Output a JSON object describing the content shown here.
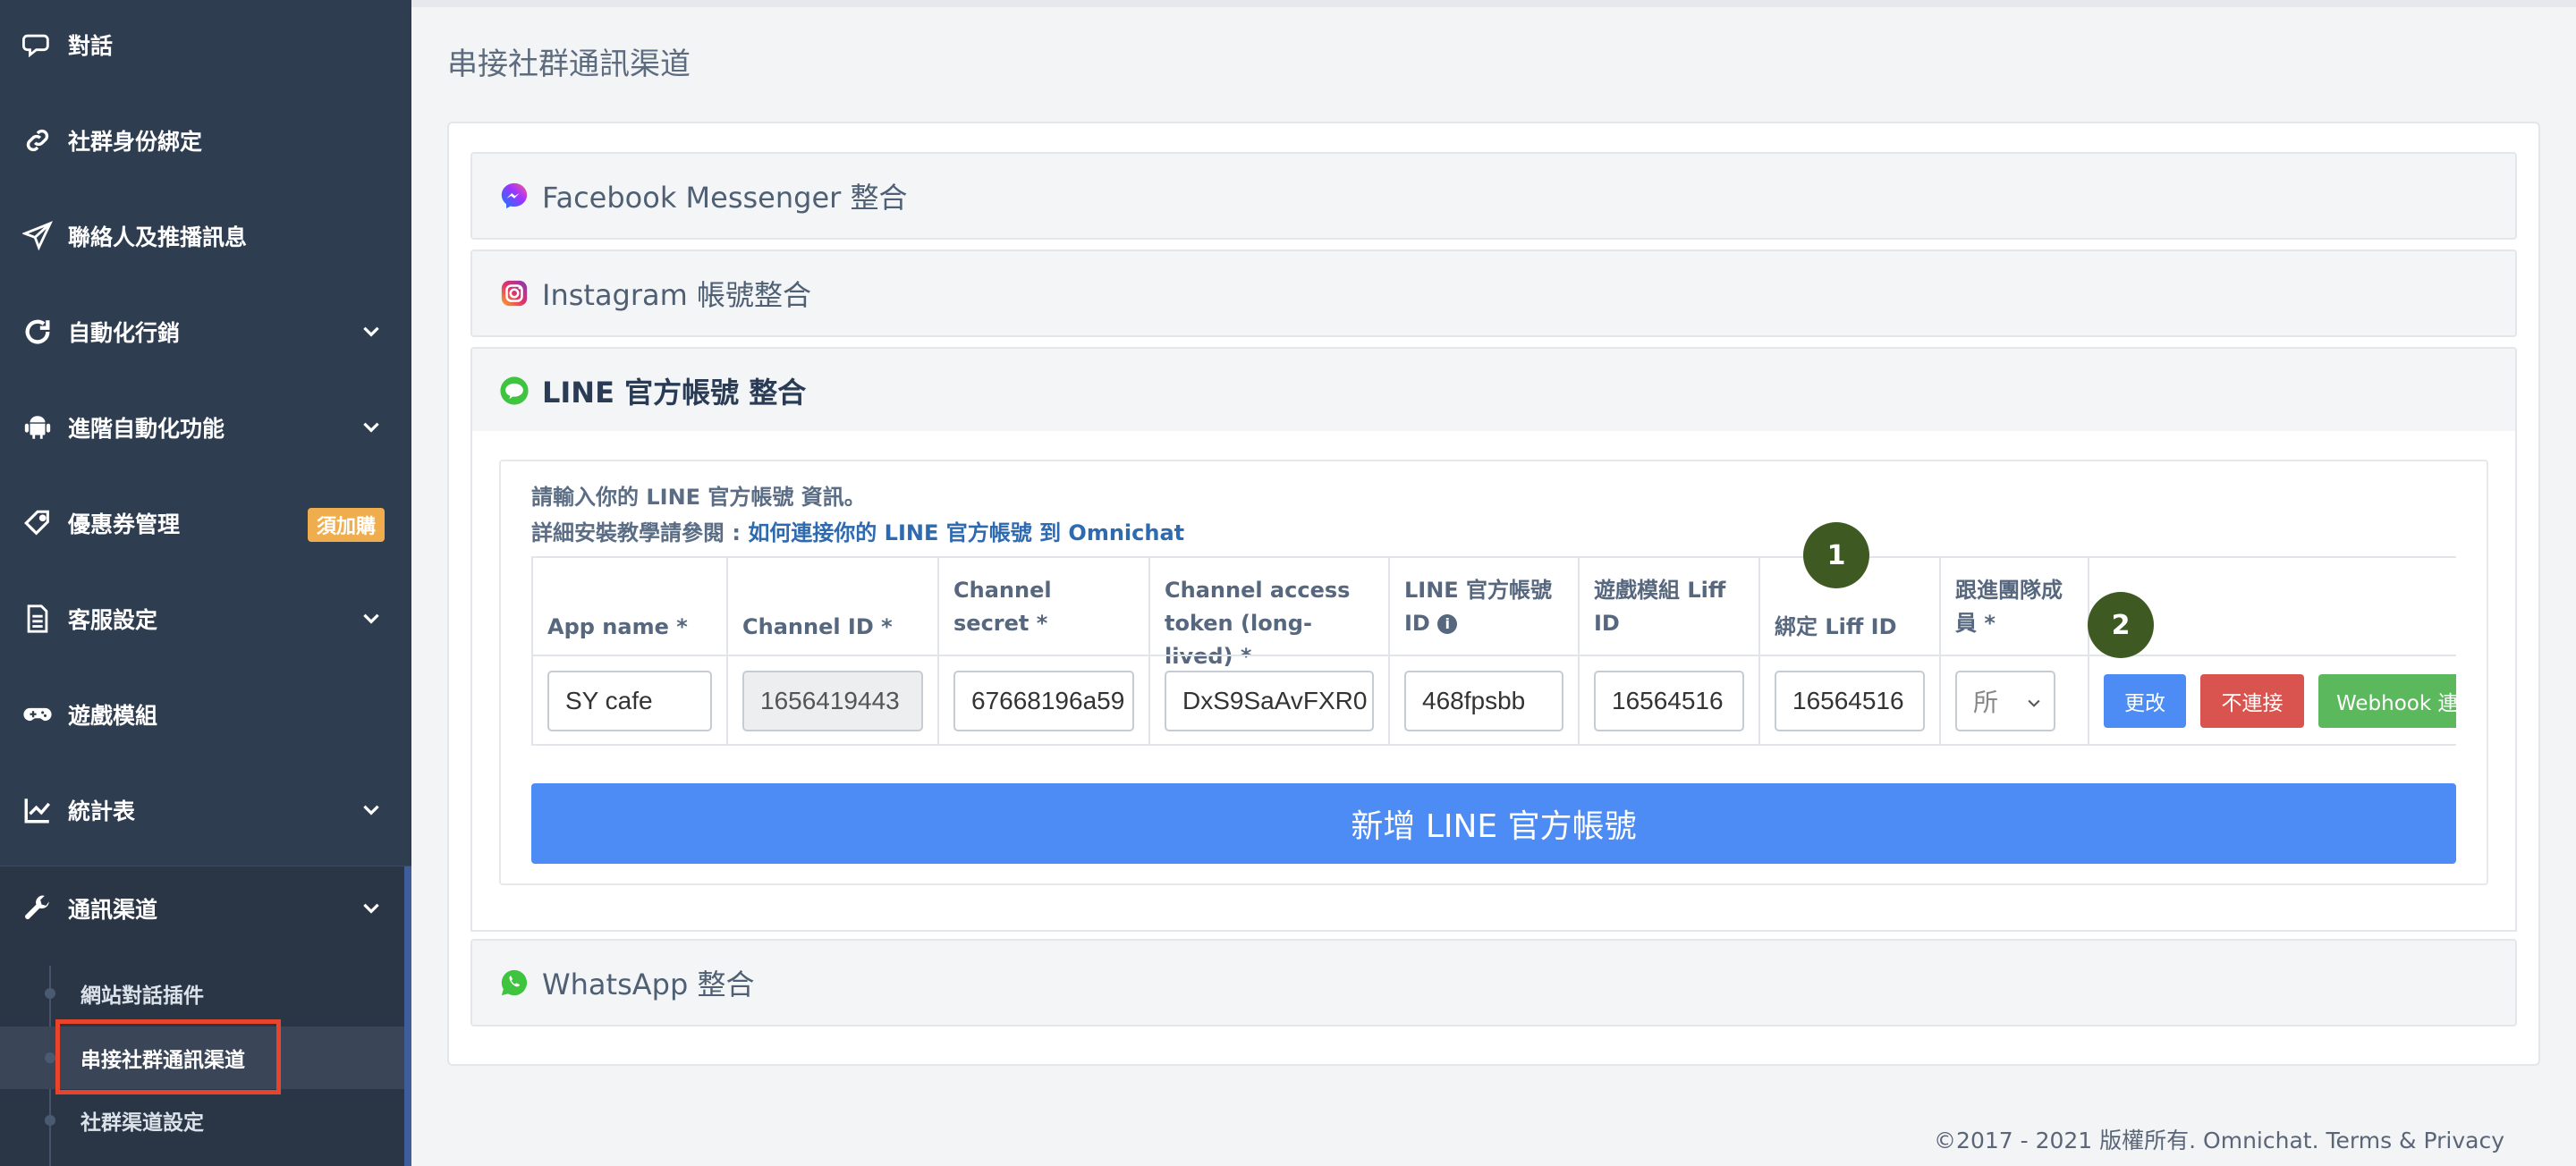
{
  "sidebar": {
    "items": [
      {
        "label": "對話",
        "icon": "chat-icon"
      },
      {
        "label": "社群身份綁定",
        "icon": "link-icon"
      },
      {
        "label": "聯絡人及推播訊息",
        "icon": "paper-plane-icon"
      },
      {
        "label": "自動化行銷",
        "icon": "refresh-icon"
      },
      {
        "label": "進階自動化功能",
        "icon": "android-icon"
      },
      {
        "label": "優惠券管理",
        "icon": "tag-icon",
        "badge": "須加購"
      },
      {
        "label": "客服設定",
        "icon": "document-icon"
      },
      {
        "label": "遊戲模組",
        "icon": "gamepad-icon"
      },
      {
        "label": "統計表",
        "icon": "line-chart-icon"
      },
      {
        "label": "通訊渠道",
        "icon": "wrench-icon"
      }
    ],
    "sub_items": [
      {
        "label": "網站對話插件"
      },
      {
        "label": "串接社群通訊渠道"
      },
      {
        "label": "社群渠道設定"
      }
    ]
  },
  "main": {
    "title": "串接社群通訊渠道",
    "panels": {
      "facebook": "Facebook Messenger 整合",
      "instagram": "Instagram 帳號整合",
      "line": "LINE 官方帳號 整合",
      "whatsapp": "WhatsApp 整合"
    },
    "line": {
      "intro_line1": "請輸入你的 LINE 官方帳號 資訊。",
      "intro_line2_prefix": "詳細安裝教學請參閱 : ",
      "intro_line2_link": "如何連接你的 LINE 官方帳號 到 Omnichat",
      "columns": {
        "app_name": "App name *",
        "channel_id": "Channel ID *",
        "channel_secret": "Channel secret *",
        "access_token": "Channel access token (long-lived) *",
        "official_id": "LINE 官方帳號 ID",
        "game_liff": "遊戲模組 Liff ID",
        "bind_liff": "綁定 Liff ID",
        "team_member": "跟進團隊成員 *"
      },
      "row": {
        "app_name": "SY cafe",
        "channel_id": "1656419443",
        "channel_secret": "67668196a59",
        "access_token": "DxS9SaAvFXR0",
        "official_id": "468fpsbb",
        "game_liff": "16564516",
        "bind_liff": "16564516",
        "team_member": "所"
      },
      "actions": {
        "edit": "更改",
        "disconnect": "不連接",
        "webhook": "Webhook 連結"
      },
      "add_button": "新增 LINE 官方帳號"
    },
    "markers": [
      "1",
      "2"
    ]
  },
  "footer": {
    "copyright": "©2017 - 2021 版權所有. Omnichat. Terms & Privacy"
  },
  "colors": {
    "sidebar_bg": "#2f3d50",
    "primary": "#4d8cf5",
    "danger": "#d9534f",
    "success": "#5cb85c",
    "badge": "#f0ad4e",
    "highlight": "#e8442b",
    "marker": "#3e5a22"
  }
}
